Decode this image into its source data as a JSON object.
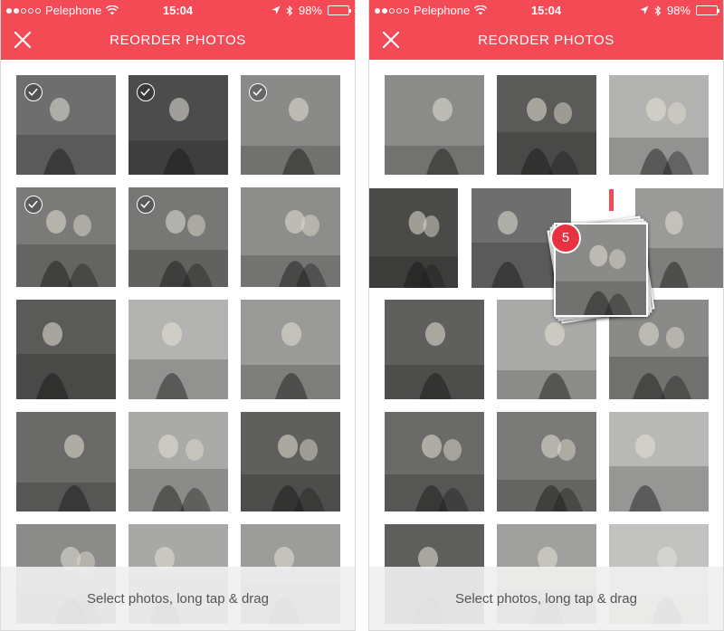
{
  "screens": [
    {
      "status": {
        "carrier": "Pelephone",
        "time": "15:04",
        "battery": "98%"
      },
      "header": {
        "title": "REORDER PHOTOS"
      },
      "footer": {
        "hint": "Select photos, long tap & drag"
      },
      "photos": [
        {
          "selected": true,
          "tone": "#6e6e6e"
        },
        {
          "selected": true,
          "tone": "#4c4c4c"
        },
        {
          "selected": true,
          "tone": "#8a8a88"
        },
        {
          "selected": true,
          "tone": "#7a7a78"
        },
        {
          "selected": true,
          "tone": "#777775"
        },
        {
          "selected": false,
          "tone": "#8d8d8b"
        },
        {
          "selected": false,
          "tone": "#5a5a58"
        },
        {
          "selected": false,
          "tone": "#b3b3b1"
        },
        {
          "selected": false,
          "tone": "#9a9a98"
        },
        {
          "selected": false,
          "tone": "#6a6a68"
        },
        {
          "selected": false,
          "tone": "#aaaaa8"
        },
        {
          "selected": false,
          "tone": "#5f5f5d"
        },
        {
          "selected": false,
          "tone": "#8b8b89"
        },
        {
          "selected": false,
          "tone": "#a8a8a6"
        },
        {
          "selected": false,
          "tone": "#9c9c9a"
        }
      ]
    },
    {
      "status": {
        "carrier": "Pelephone",
        "time": "15:04",
        "battery": "98%"
      },
      "header": {
        "title": "REORDER PHOTOS"
      },
      "footer": {
        "hint": "Select photos, long tap & drag"
      },
      "drag": {
        "count": "5"
      },
      "photos": [
        {
          "tone": "#8b8b89"
        },
        {
          "tone": "#5a5a58"
        },
        {
          "tone": "#b3b3b1"
        },
        {
          "tone": "#4a4a48"
        },
        {
          "tone": "#6e6e6e"
        },
        {
          "tone": "#9a9a98"
        },
        {
          "tone": "#5f5f5d"
        },
        {
          "tone": "#aaaaa8"
        },
        {
          "tone": "#8a8a88"
        },
        {
          "tone": "#6a6a68"
        },
        {
          "tone": "#7a7a78"
        },
        {
          "tone": "#b8b8b6"
        },
        {
          "tone": "#5e5e5c"
        },
        {
          "tone": "#a0a09e"
        },
        {
          "tone": "#c2c2c0"
        }
      ]
    }
  ],
  "colors": {
    "accent": "#f44a56",
    "badge": "#e8323f"
  },
  "icons": {
    "close": "close-icon",
    "check": "check-icon",
    "wifi": "wifi-icon",
    "location": "location-arrow-icon",
    "bluetooth": "bluetooth-icon",
    "battery": "battery-icon"
  }
}
